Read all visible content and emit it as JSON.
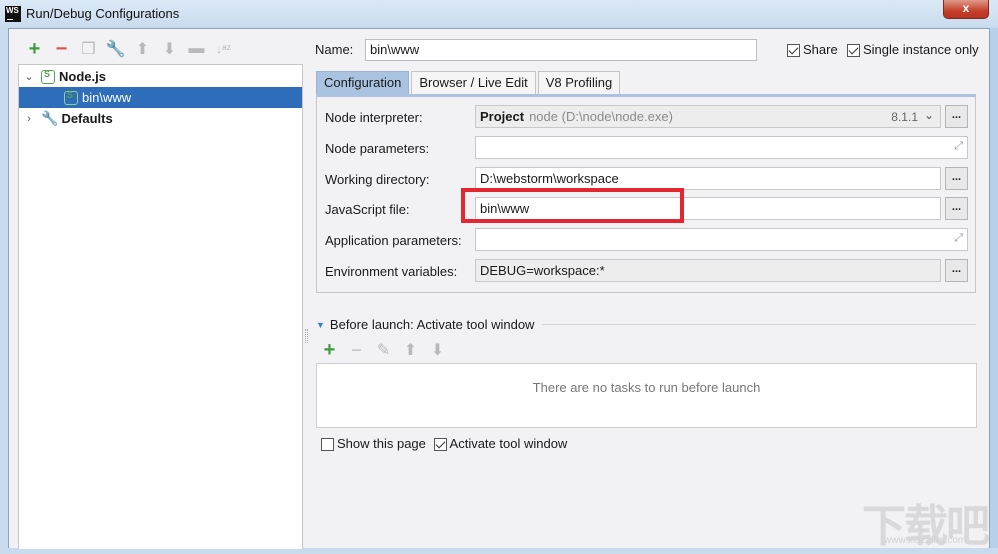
{
  "window": {
    "title": "Run/Debug Configurations",
    "app_icon_text": "WS",
    "close_label": "x"
  },
  "left_toolbar": {
    "icons": [
      "add-icon",
      "remove-icon",
      "copy-icon",
      "edit-defaults-icon",
      "move-up-icon",
      "move-down-icon",
      "folder-icon",
      "sort-icon"
    ]
  },
  "tree": {
    "items": [
      {
        "label": "Node.js",
        "expanded": true,
        "bold": true
      },
      {
        "label": "bin\\www",
        "selected": true
      },
      {
        "label": "Defaults",
        "expanded": false,
        "bold": true
      }
    ]
  },
  "header": {
    "name_label": "Name:",
    "name_value": "bin\\www",
    "share_label": "Share",
    "share_checked": true,
    "single_instance_label": "Single instance only",
    "single_instance_checked": true
  },
  "tabs": [
    {
      "label": "Configuration",
      "active": true
    },
    {
      "label": "Browser / Live Edit",
      "active": false
    },
    {
      "label": "V8 Profiling",
      "active": false
    }
  ],
  "config": {
    "node_interpreter": {
      "label": "Node interpreter:",
      "project": "Project",
      "path": "node (D:\\node\\node.exe)",
      "version": "8.1.1"
    },
    "node_parameters": {
      "label": "Node parameters:",
      "value": ""
    },
    "working_directory": {
      "label": "Working directory:",
      "value": "D:\\webstorm\\workspace"
    },
    "javascript_file": {
      "label": "JavaScript file:",
      "value": "bin\\www"
    },
    "application_parameters": {
      "label": "Application parameters:",
      "value": ""
    },
    "environment_variables": {
      "label": "Environment variables:",
      "value": "DEBUG=workspace:*"
    },
    "browse_label": "..."
  },
  "before_launch": {
    "title": "Before launch: Activate tool window",
    "empty_text": "There are no tasks to run before launch",
    "show_this_page_label": "Show this page",
    "show_this_page_checked": false,
    "activate_tool_window_label": "Activate tool window",
    "activate_tool_window_checked": true
  },
  "watermark": {
    "text": "下载吧",
    "url": "www.xiazaiba.com"
  }
}
